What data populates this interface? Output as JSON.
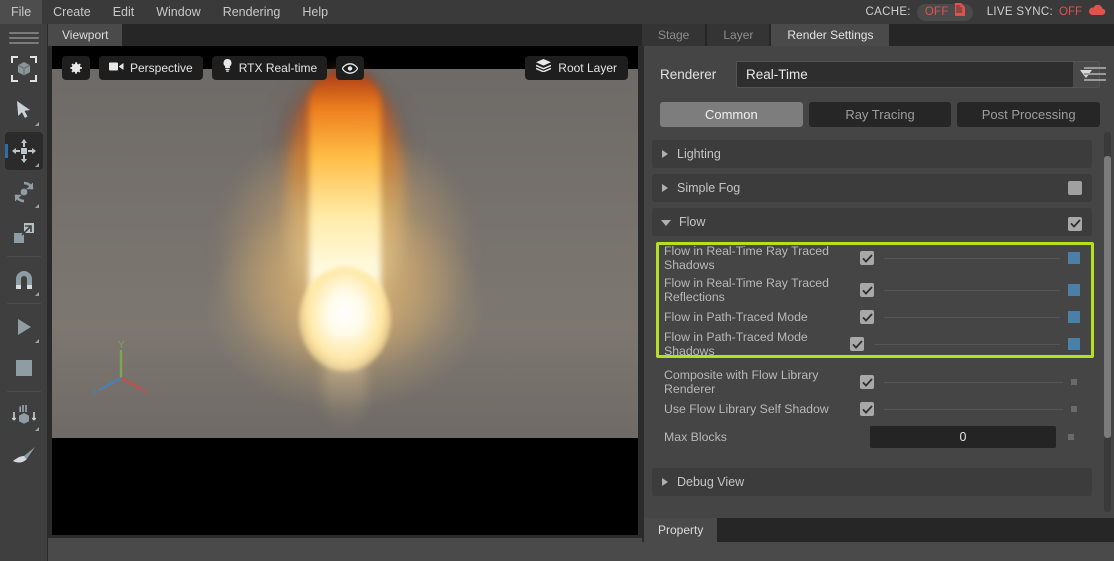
{
  "menubar": {
    "items": [
      {
        "label": "File"
      },
      {
        "label": "Create"
      },
      {
        "label": "Edit"
      },
      {
        "label": "Window"
      },
      {
        "label": "Rendering"
      },
      {
        "label": "Help"
      }
    ],
    "cache": {
      "label": "CACHE:",
      "state": "OFF",
      "icon": "cache-document-icon"
    },
    "live_sync": {
      "label": "LIVE SYNC:",
      "state": "OFF",
      "icon": "cloud-icon"
    },
    "status_color": "#e0524c"
  },
  "left_toolbar": {
    "handle": "drag-handle",
    "tools": [
      {
        "name": "select-bounding-box-tool",
        "active": false
      },
      {
        "name": "pointer-select-tool",
        "active": false
      },
      {
        "name": "move-tool",
        "active": true
      },
      {
        "name": "rotate-tool",
        "active": false
      },
      {
        "name": "scale-tool",
        "active": false
      },
      {
        "name": "snap-magnet-tool",
        "active": false
      },
      {
        "name": "play-tool",
        "active": false
      },
      {
        "name": "stop-tool",
        "active": false
      },
      {
        "name": "physics-drop-tool",
        "active": false
      },
      {
        "name": "paint-brush-tool",
        "active": false
      }
    ]
  },
  "viewport": {
    "tab_label": "Viewport",
    "toolbar": {
      "settings_icon": "gear-icon",
      "camera": {
        "icon": "camera-icon",
        "label": "Perspective"
      },
      "renderer": {
        "icon": "lightbulb-icon",
        "label": "RTX Real-time"
      },
      "visibility_icon": "eye-icon",
      "layer": {
        "icon": "layers-icon",
        "label": "Root Layer"
      }
    },
    "axis_gizmo": {
      "x": "x",
      "y": "y",
      "z": "z",
      "x_color": "#c0504d",
      "y_color": "#7ba84f",
      "z_color": "#4a7fb5"
    },
    "content_description": "fire simulation render"
  },
  "right_panel": {
    "tabs": [
      {
        "label": "Stage",
        "active": false
      },
      {
        "label": "Layer",
        "active": false
      },
      {
        "label": "Render Settings",
        "active": true
      }
    ],
    "renderer": {
      "label": "Renderer",
      "value": "Real-Time",
      "arrow_icon": "chevron-down-icon",
      "menu_icon": "hamburger-menu-icon"
    },
    "subtabs": [
      {
        "label": "Common",
        "active": true
      },
      {
        "label": "Ray Tracing",
        "active": false
      },
      {
        "label": "Post Processing",
        "active": false
      }
    ],
    "sections": [
      {
        "title": "Lighting",
        "expanded": false,
        "has_checkbox": false,
        "checked": false
      },
      {
        "title": "Simple Fog",
        "expanded": false,
        "has_checkbox": true,
        "checked": false
      },
      {
        "title": "Flow",
        "expanded": true,
        "has_checkbox": true,
        "checked": true
      }
    ],
    "flow_properties_highlighted": [
      {
        "label": "Flow in Real-Time Ray Traced Shadows",
        "checked": true,
        "marker": "blue"
      },
      {
        "label": "Flow in Real-Time Ray Traced Reflections",
        "checked": true,
        "marker": "blue"
      },
      {
        "label": "Flow in Path-Traced Mode",
        "checked": true,
        "marker": "blue"
      },
      {
        "label": "Flow in Path-Traced Mode Shadows",
        "checked": true,
        "marker": "blue"
      }
    ],
    "flow_properties_rest": [
      {
        "label": "Composite with Flow Library Renderer",
        "type": "checkbox",
        "checked": true,
        "marker": "gray"
      },
      {
        "label": "Use Flow Library Self Shadow",
        "type": "checkbox",
        "checked": true,
        "marker": "gray"
      },
      {
        "label": "Max Blocks",
        "type": "number",
        "value": "0",
        "marker": "gray"
      }
    ],
    "debug_section": {
      "title": "Debug View",
      "expanded": false
    },
    "property_tab": {
      "label": "Property"
    },
    "highlight_color": "#b4e021",
    "marker_blue_color": "#4a80a8"
  }
}
